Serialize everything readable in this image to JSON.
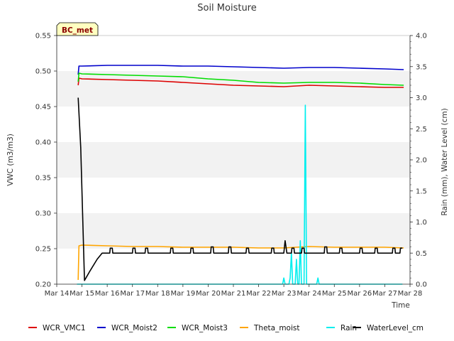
{
  "chart_data": {
    "type": "line",
    "title": "Soil Moisture",
    "badge": "BC_met",
    "xlabel": "Time",
    "ylabel_left": "VWC (m3/m3)",
    "ylabel_right": "Rain (mm), Water Level (cm)",
    "x_ticks": [
      "Mar 14",
      "Mar 15",
      "Mar 16",
      "Mar 17",
      "Mar 18",
      "Mar 19",
      "Mar 20",
      "Mar 21",
      "Mar 22",
      "Mar 23",
      "Mar 24",
      "Mar 25",
      "Mar 26",
      "Mar 27",
      "Mar 28"
    ],
    "xlim": [
      0,
      14
    ],
    "ylim_left": [
      0.2,
      0.55
    ],
    "y_left_ticks": [
      "0.20",
      "0.25",
      "0.30",
      "0.35",
      "0.40",
      "0.45",
      "0.50",
      "0.55"
    ],
    "ylim_right": [
      0.0,
      4.0
    ],
    "y_right_ticks": [
      "0.0",
      "0.5",
      "1.0",
      "1.5",
      "2.0",
      "2.5",
      "3.0",
      "3.5",
      "4.0"
    ],
    "bands": [
      [
        0.25,
        0.3
      ],
      [
        0.35,
        0.4
      ],
      [
        0.45,
        0.5
      ]
    ],
    "legend_position": "bottom",
    "series": [
      {
        "name": "WCR_VMC1",
        "axis": "left",
        "color": "#dd0000",
        "points": [
          [
            0.85,
            0.48
          ],
          [
            0.88,
            0.49
          ],
          [
            1.0,
            0.489
          ],
          [
            2.0,
            0.488
          ],
          [
            3.0,
            0.487
          ],
          [
            4.0,
            0.486
          ],
          [
            5.0,
            0.484
          ],
          [
            6.0,
            0.482
          ],
          [
            7.0,
            0.48
          ],
          [
            8.0,
            0.479
          ],
          [
            9.0,
            0.478
          ],
          [
            10.0,
            0.48
          ],
          [
            11.0,
            0.479
          ],
          [
            12.0,
            0.478
          ],
          [
            13.0,
            0.477
          ],
          [
            13.75,
            0.477
          ]
        ]
      },
      {
        "name": "WCR_Moist2",
        "axis": "left",
        "color": "#0000cc",
        "points": [
          [
            0.85,
            0.495
          ],
          [
            0.88,
            0.507
          ],
          [
            1.0,
            0.507
          ],
          [
            2.0,
            0.508
          ],
          [
            3.0,
            0.508
          ],
          [
            4.0,
            0.508
          ],
          [
            5.0,
            0.507
          ],
          [
            6.0,
            0.507
          ],
          [
            7.0,
            0.506
          ],
          [
            8.0,
            0.505
          ],
          [
            9.0,
            0.504
          ],
          [
            10.0,
            0.505
          ],
          [
            11.0,
            0.505
          ],
          [
            12.0,
            0.504
          ],
          [
            13.0,
            0.503
          ],
          [
            13.75,
            0.502
          ]
        ]
      },
      {
        "name": "WCR_Moist3",
        "axis": "left",
        "color": "#00dd00",
        "points": [
          [
            0.85,
            0.485
          ],
          [
            0.88,
            0.497
          ],
          [
            1.0,
            0.496
          ],
          [
            2.0,
            0.495
          ],
          [
            3.0,
            0.494
          ],
          [
            4.0,
            0.493
          ],
          [
            5.0,
            0.492
          ],
          [
            6.0,
            0.489
          ],
          [
            7.0,
            0.487
          ],
          [
            8.0,
            0.484
          ],
          [
            9.0,
            0.483
          ],
          [
            10.0,
            0.484
          ],
          [
            11.0,
            0.484
          ],
          [
            12.0,
            0.483
          ],
          [
            13.0,
            0.481
          ],
          [
            13.75,
            0.48
          ]
        ]
      },
      {
        "name": "Theta_moist",
        "axis": "left",
        "color": "#ffa500",
        "points": [
          [
            0.85,
            0.206
          ],
          [
            0.88,
            0.254
          ],
          [
            1.0,
            0.255
          ],
          [
            2.0,
            0.254
          ],
          [
            3.0,
            0.253
          ],
          [
            4.0,
            0.253
          ],
          [
            5.0,
            0.252
          ],
          [
            6.0,
            0.252
          ],
          [
            7.0,
            0.252
          ],
          [
            8.0,
            0.251
          ],
          [
            9.0,
            0.251
          ],
          [
            10.0,
            0.253
          ],
          [
            11.0,
            0.252
          ],
          [
            12.0,
            0.252
          ],
          [
            13.0,
            0.252
          ],
          [
            13.75,
            0.251
          ]
        ]
      },
      {
        "name": "Rain",
        "axis": "right",
        "color": "#00eeee",
        "points": [
          [
            0.8,
            0.0
          ],
          [
            8.95,
            0.0
          ],
          [
            9.0,
            0.1
          ],
          [
            9.05,
            0.0
          ],
          [
            9.2,
            0.0
          ],
          [
            9.25,
            0.1
          ],
          [
            9.3,
            0.5
          ],
          [
            9.35,
            0.0
          ],
          [
            9.45,
            0.0
          ],
          [
            9.5,
            0.4
          ],
          [
            9.55,
            0.0
          ],
          [
            9.6,
            0.0
          ],
          [
            9.65,
            0.7
          ],
          [
            9.7,
            0.0
          ],
          [
            9.8,
            0.0
          ],
          [
            9.85,
            2.88
          ],
          [
            9.9,
            0.0
          ],
          [
            10.3,
            0.0
          ],
          [
            10.35,
            0.1
          ],
          [
            10.4,
            0.0
          ],
          [
            13.7,
            0.0
          ]
        ]
      },
      {
        "name": "WaterLevel_cm",
        "axis": "right",
        "color": "#000000",
        "points": [
          [
            0.85,
            3.0
          ],
          [
            0.95,
            2.2
          ],
          [
            1.1,
            0.06
          ],
          [
            1.3,
            0.2
          ],
          [
            1.6,
            0.4
          ],
          [
            1.8,
            0.5
          ],
          [
            2.0,
            0.5
          ],
          [
            2.1,
            0.5
          ],
          [
            2.12,
            0.58
          ],
          [
            2.2,
            0.58
          ],
          [
            2.22,
            0.5
          ],
          [
            3.0,
            0.5
          ],
          [
            3.02,
            0.58
          ],
          [
            3.1,
            0.58
          ],
          [
            3.12,
            0.5
          ],
          [
            3.5,
            0.5
          ],
          [
            3.52,
            0.58
          ],
          [
            3.6,
            0.58
          ],
          [
            3.62,
            0.5
          ],
          [
            4.5,
            0.5
          ],
          [
            4.52,
            0.58
          ],
          [
            4.6,
            0.58
          ],
          [
            4.62,
            0.5
          ],
          [
            5.3,
            0.5
          ],
          [
            5.32,
            0.58
          ],
          [
            5.4,
            0.58
          ],
          [
            5.42,
            0.5
          ],
          [
            6.1,
            0.5
          ],
          [
            6.12,
            0.6
          ],
          [
            6.2,
            0.6
          ],
          [
            6.22,
            0.5
          ],
          [
            6.8,
            0.5
          ],
          [
            6.82,
            0.6
          ],
          [
            6.9,
            0.6
          ],
          [
            6.92,
            0.5
          ],
          [
            7.5,
            0.5
          ],
          [
            7.52,
            0.58
          ],
          [
            7.6,
            0.58
          ],
          [
            7.62,
            0.5
          ],
          [
            8.5,
            0.5
          ],
          [
            8.52,
            0.58
          ],
          [
            8.6,
            0.58
          ],
          [
            8.62,
            0.5
          ],
          [
            9.0,
            0.5
          ],
          [
            9.05,
            0.7
          ],
          [
            9.12,
            0.5
          ],
          [
            9.3,
            0.5
          ],
          [
            9.32,
            0.58
          ],
          [
            9.4,
            0.58
          ],
          [
            9.42,
            0.5
          ],
          [
            9.7,
            0.5
          ],
          [
            9.72,
            0.58
          ],
          [
            9.8,
            0.58
          ],
          [
            9.82,
            0.5
          ],
          [
            10.6,
            0.5
          ],
          [
            10.62,
            0.6
          ],
          [
            10.7,
            0.6
          ],
          [
            10.72,
            0.5
          ],
          [
            11.2,
            0.5
          ],
          [
            11.22,
            0.58
          ],
          [
            11.3,
            0.58
          ],
          [
            11.32,
            0.5
          ],
          [
            12.0,
            0.5
          ],
          [
            12.02,
            0.58
          ],
          [
            12.1,
            0.58
          ],
          [
            12.12,
            0.5
          ],
          [
            12.6,
            0.5
          ],
          [
            12.62,
            0.58
          ],
          [
            12.7,
            0.58
          ],
          [
            12.72,
            0.5
          ],
          [
            13.3,
            0.5
          ],
          [
            13.32,
            0.58
          ],
          [
            13.4,
            0.58
          ],
          [
            13.42,
            0.5
          ],
          [
            13.6,
            0.5
          ],
          [
            13.62,
            0.58
          ],
          [
            13.7,
            0.58
          ]
        ]
      }
    ]
  }
}
